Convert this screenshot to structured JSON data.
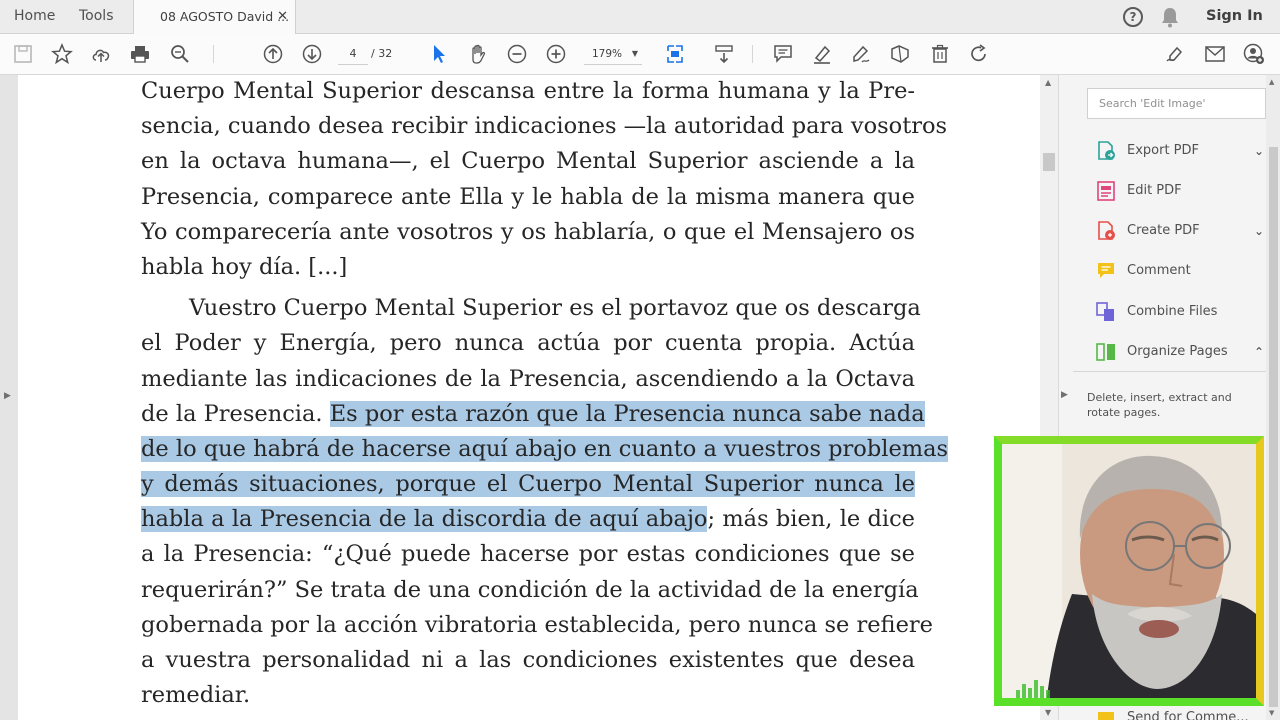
{
  "tabs": {
    "home": "Home",
    "tools": "Tools",
    "document": "08 AGOSTO David ...",
    "close": "✕"
  },
  "header": {
    "help": "?",
    "sign_in": "Sign In"
  },
  "toolbar": {
    "current_page": "4",
    "total_pages": "/ 32",
    "zoom": "179%"
  },
  "document": {
    "paragraph1": [
      "Cuerpo Mental Superior descansa entre la forma humana y la Pre-",
      "sencia, cuando desea recibir indicaciones —la autoridad para vosotros",
      "en la octava humana—, el Cuerpo Mental Superior asciende a la",
      "Presencia, comparece ante Ella y le habla de la misma manera que",
      "Yo comparecería ante vosotros y os hablaría, o que el Mensajero os",
      "habla hoy día. [...]"
    ],
    "paragraph2": {
      "line1": "Vuestro Cuerpo Mental Superior es el portavoz que os descarga",
      "line2": "el Poder y Energía, pero nunca actúa por cuenta propia. Actúa",
      "line3": "mediante las indicaciones de la Presencia, ascendiendo a la Octava",
      "line4_plain": "de la Presencia. ",
      "line4_highlight": "Es por esta razón que la Presencia nunca sabe nada",
      "line5_highlight": "de lo que habrá de hacerse aquí abajo en cuanto a vuestros problemas",
      "line6_highlight": "y demás situaciones, porque el Cuerpo Mental Superior nunca le",
      "line7_highlight": "habla a la Presencia de la discordia de aquí abajo",
      "line7_plain": "; más bien, le dice",
      "line8": "a la Presencia: “¿Qué puede hacerse por estas condiciones que se",
      "line9": "requerirán?” Se trata de una condición de la actividad de la energía",
      "line10": "gobernada por la acción vibratoria establecida, pero nunca se refiere",
      "line11": "a vuestra personalidad ni a las condiciones existentes que desea",
      "line12": "remediar."
    }
  },
  "right_panel": {
    "search_placeholder": "Search 'Edit Image'",
    "items": [
      {
        "label": "Export PDF",
        "chevron": "⌄",
        "color": "#2aa39a"
      },
      {
        "label": "Edit PDF",
        "chevron": "",
        "color": "#e0457b"
      },
      {
        "label": "Create PDF",
        "chevron": "⌄",
        "color": "#e5504a"
      },
      {
        "label": "Comment",
        "chevron": "",
        "color": "#f2c21b"
      },
      {
        "label": "Combine Files",
        "chevron": "",
        "color": "#6f63d8"
      },
      {
        "label": "Organize Pages",
        "chevron": "⌃",
        "color": "#55b848"
      }
    ],
    "description": "Delete, insert, extract and rotate pages.",
    "partial_item": "Send for Comme..."
  },
  "colors": {
    "highlight": "#a9c9e5",
    "webcam_border": "#5be02a"
  }
}
